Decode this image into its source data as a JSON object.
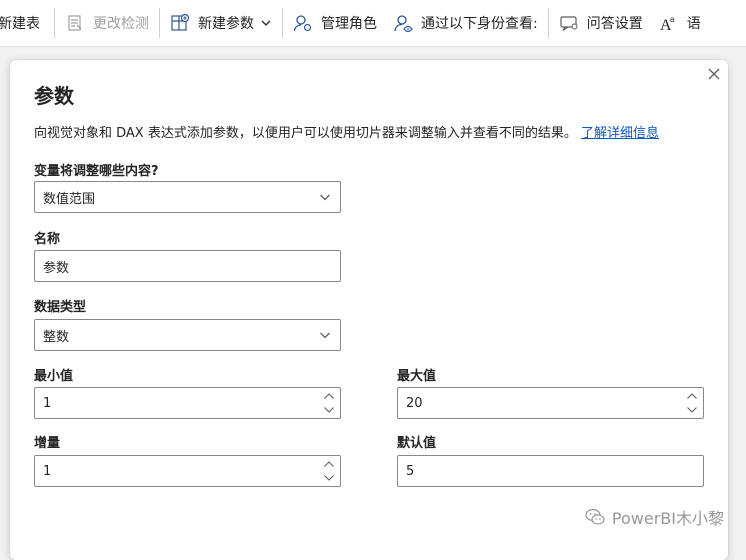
{
  "ribbon": {
    "items": [
      {
        "label": "新建表",
        "icon": "new-table-icon"
      },
      {
        "label": "更改检测",
        "icon": "change-detection-icon",
        "disabled": true
      },
      {
        "label": "新建参数",
        "icon": "new-parameter-icon",
        "dropdown": true
      },
      {
        "label": "管理角色",
        "icon": "manage-roles-icon"
      },
      {
        "label": "通过以下身份查看:",
        "icon": "view-as-icon"
      },
      {
        "label": "问答设置",
        "icon": "qa-setup-icon"
      },
      {
        "label": "语",
        "icon": "language-icon"
      }
    ]
  },
  "dialog": {
    "title": "参数",
    "description": "向视觉对象和 DAX 表达式添加参数，以便用户可以使用切片器来调整输入并查看不同的结果。",
    "learn_more": "了解详细信息",
    "adjust_label": "变量将调整哪些内容?",
    "adjust_value": "数值范围",
    "name_label": "名称",
    "name_value": "参数",
    "datatype_label": "数据类型",
    "datatype_value": "整数",
    "min_label": "最小值",
    "min_value": "1",
    "max_label": "最大值",
    "max_value": "20",
    "increment_label": "增量",
    "increment_value": "1",
    "default_label": "默认值",
    "default_value": "5"
  },
  "watermark": "PowerBI木小黎",
  "colors": {
    "link": "#0a56c2",
    "border": "#8a8886",
    "disabled": "#a19f9d"
  }
}
